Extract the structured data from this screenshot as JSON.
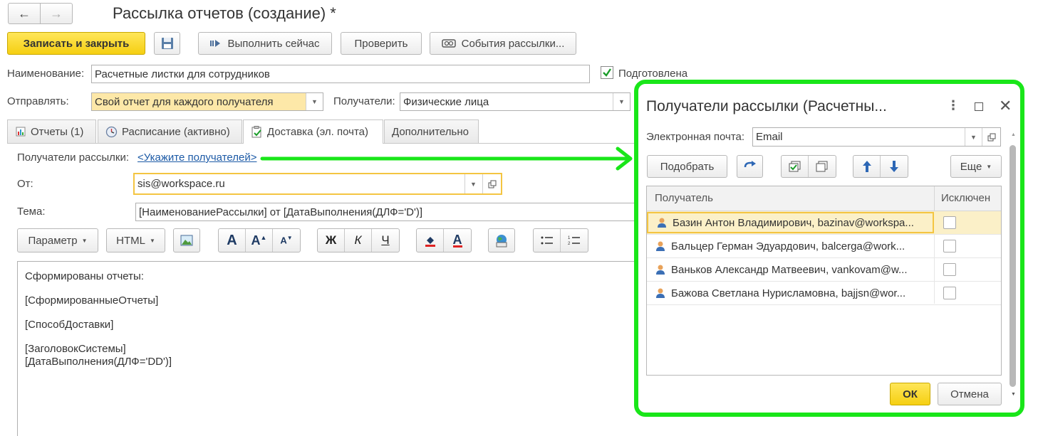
{
  "nav": {
    "back": "←",
    "forward": "→"
  },
  "window": {
    "title": "Рассылка отчетов (создание) *"
  },
  "toolbar": {
    "save_close": "Записать и закрыть",
    "run_now": "Выполнить сейчас",
    "check": "Проверить",
    "events": "События рассылки..."
  },
  "form": {
    "name_label": "Наименование:",
    "name_value": "Расчетные листки для сотрудников",
    "prepared_label": "Подготовлена",
    "send_label": "Отправлять:",
    "send_value": "Свой отчет для каждого получателя",
    "recipients_label": "Получатели:",
    "recipients_value": "Физические лица"
  },
  "tabs": [
    {
      "label": "Отчеты (1)"
    },
    {
      "label": "Расписание (активно)"
    },
    {
      "label": "Доставка (эл. почта)"
    },
    {
      "label": "Дополнительно"
    }
  ],
  "delivery": {
    "recipients_label": "Получатели рассылки:",
    "recipients_link": "<Укажите получателей>",
    "from_label": "От:",
    "from_value": "sis@workspace.ru",
    "subject_label": "Тема:",
    "subject_value": "[НаименованиеРассылки] от [ДатаВыполнения(ДЛФ='D')]"
  },
  "editor_toolbar": {
    "param": "Параметр",
    "html": "HTML",
    "bold": "Ж",
    "italic": "К",
    "underline": "Ч"
  },
  "body_lines": [
    "Сформированы отчеты:",
    "[СформированныеОтчеты]",
    "[СпособДоставки]",
    "[ЗаголовокСистемы]",
    "[ДатаВыполнения(ДЛФ='DD')]"
  ],
  "dialog": {
    "title": "Получатели рассылки (Расчетны...",
    "email_label": "Электронная почта:",
    "email_value": "Email",
    "pick": "Подобрать",
    "more": "Еще",
    "col_recipient": "Получатель",
    "col_excluded": "Исключен",
    "rows": [
      "Базин Антон Владимирович, bazinav@workspa...",
      "Бальцер Герман Эдуардович, balcerga@work...",
      "Ваньков Александр Матвеевич, vankovam@w...",
      "Бажова Светлана Нурисламовна, bajjsn@wor..."
    ],
    "ok": "ОК",
    "cancel": "Отмена"
  },
  "colors": {
    "accent_yellow": "#f5cf12",
    "highlight_green": "#19e619",
    "link": "#1c5aa6"
  }
}
